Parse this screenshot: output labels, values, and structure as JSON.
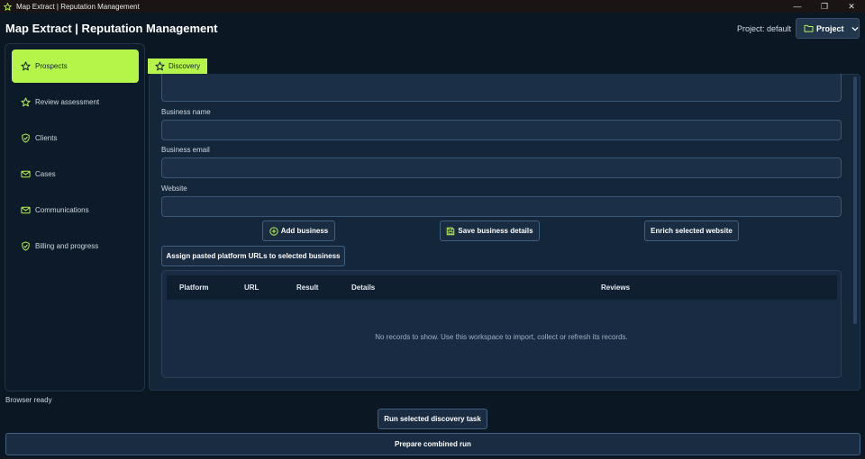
{
  "window": {
    "title": "Map Extract | Reputation Management",
    "controls": {
      "minimize": "—",
      "restore": "❐",
      "close": "✕"
    }
  },
  "header": {
    "app_title": "Map Extract | Reputation Management",
    "project_label": "Project: default",
    "project_button": "Project"
  },
  "sidebar": {
    "items": [
      {
        "label": "Prospects",
        "icon": "star-icon",
        "active": true
      },
      {
        "label": "Review assessment",
        "icon": "star-icon",
        "active": false
      },
      {
        "label": "Clients",
        "icon": "shield-check-icon",
        "active": false
      },
      {
        "label": "Cases",
        "icon": "mail-icon",
        "active": false
      },
      {
        "label": "Communications",
        "icon": "mail-icon",
        "active": false
      },
      {
        "label": "Billing and progress",
        "icon": "shield-check-icon",
        "active": false
      }
    ]
  },
  "tabs": {
    "discovery": "Discovery"
  },
  "form": {
    "business_name_label": "Business name",
    "business_name_value": "",
    "business_email_label": "Business email",
    "business_email_value": "",
    "website_label": "Website",
    "website_value": ""
  },
  "buttons": {
    "add_business": "Add business",
    "save_business_details": "Save business details",
    "enrich_selected_website": "Enrich selected website",
    "assign_urls": "Assign pasted platform URLs to selected business"
  },
  "table": {
    "columns": [
      "Platform",
      "URL",
      "Result",
      "Details",
      "Reviews"
    ],
    "rows": [],
    "empty_message": "No records to show. Use this workspace to import, collect or refresh its records."
  },
  "status": "Browser ready",
  "bottom": {
    "run_selected": "Run selected discovery task",
    "prepare_combined": "Prepare combined run"
  },
  "colors": {
    "accent": "#b5f54a",
    "background": "#0c1724",
    "panel": "#14263a",
    "field": "#1b2f47"
  }
}
